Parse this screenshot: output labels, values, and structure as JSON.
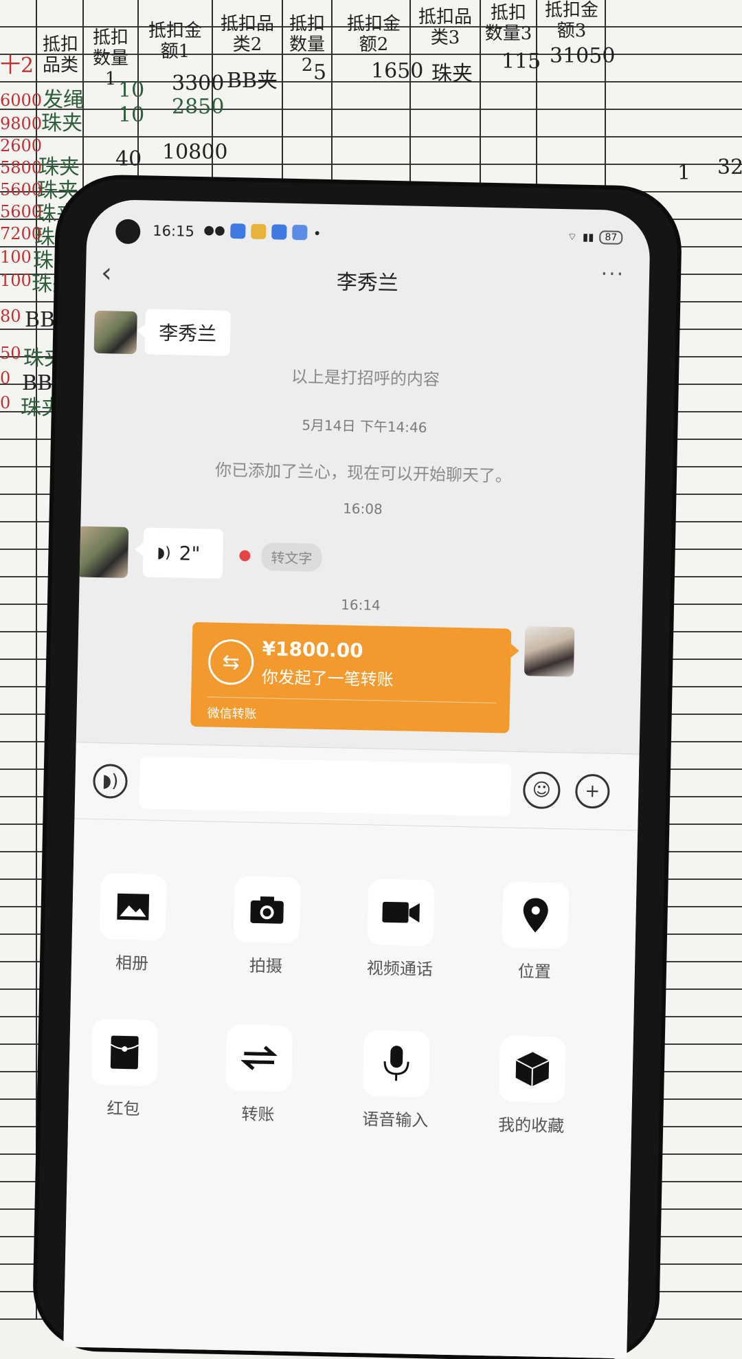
{
  "sheet": {
    "headers": [
      "抵扣品类",
      "抵扣数量1",
      "抵扣金额1",
      "抵扣品类2",
      "抵扣数量2",
      "抵扣金额2",
      "抵扣品类3",
      "抵扣数量3",
      "抵扣金额3"
    ],
    "row1": {
      "cat2": "BB夹",
      "qty2": "5",
      "amt2": "1650",
      "cat3": "珠夹",
      "qty3": "115",
      "amt3": "31050"
    },
    "left_items": [
      "发绳",
      "珠夹",
      "珠夹",
      "珠夹",
      "珠夹",
      "珠夹",
      "珠夹",
      "珠夹",
      "BB夹",
      "珠夹",
      "BB夹",
      "珠夹"
    ],
    "left_qty": [
      "10",
      "10",
      "40"
    ],
    "left_amt": [
      "3300",
      "2850",
      "10800"
    ],
    "left_edge": [
      "6000",
      "9800",
      "2600",
      "5800",
      "5600",
      "5600",
      "7200",
      "100",
      "100",
      "80",
      "50",
      "0",
      "0"
    ],
    "corner": "十2",
    "right_partial": [
      "1",
      "32"
    ]
  },
  "status": {
    "time": "16:15",
    "battery": "87"
  },
  "nav": {
    "back": "‹",
    "title": "李秀兰",
    "more": "···"
  },
  "chat": {
    "greeting_name": "李秀兰",
    "greeting_note": "以上是打招呼的内容",
    "ts1": "5月14日 下午14:46",
    "added_notice": "你已添加了兰心，现在可以开始聊天了。",
    "ts2": "16:08",
    "voice_duration": "2\"",
    "to_text": "转文字",
    "ts3": "16:14",
    "transfer": {
      "amount": "¥1800.00",
      "desc": "你发起了一笔转账",
      "footer": "微信转账"
    }
  },
  "panel": {
    "items": [
      {
        "label": "相册",
        "icon": "image-icon"
      },
      {
        "label": "拍摄",
        "icon": "camera-icon"
      },
      {
        "label": "视频通话",
        "icon": "video-icon"
      },
      {
        "label": "位置",
        "icon": "location-icon"
      },
      {
        "label": "红包",
        "icon": "red-envelope-icon"
      },
      {
        "label": "转账",
        "icon": "transfer-icon"
      },
      {
        "label": "语音输入",
        "icon": "microphone-icon"
      },
      {
        "label": "我的收藏",
        "icon": "favorites-icon"
      }
    ]
  },
  "colors": {
    "transfer": "#f29a2e",
    "chat_bg": "#ededed",
    "unread_dot": "#e54545"
  }
}
